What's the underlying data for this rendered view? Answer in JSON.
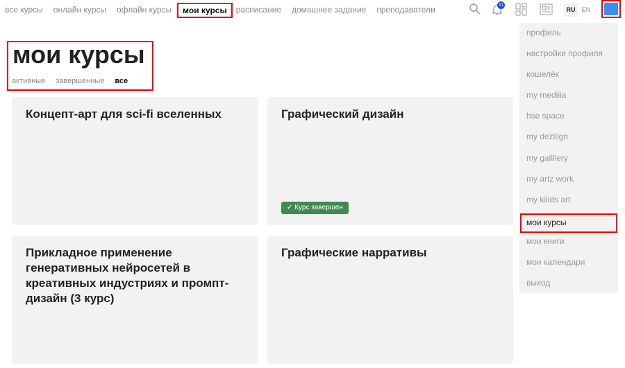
{
  "nav": [
    "все курсы",
    "онлайн курсы",
    "офлайн курсы",
    "мои курсы",
    "расписание",
    "домашнее задание",
    "преподаватели"
  ],
  "header": {
    "notifications": "11",
    "lang_ru": "RU",
    "lang_en": "EN"
  },
  "page": {
    "title": "мои курсы",
    "filters": [
      "активные",
      "завершенные",
      "все"
    ]
  },
  "courses": [
    {
      "title": "Концепт-арт для sci-fi вселенных"
    },
    {
      "title": "Графический дизайн",
      "badge": "Курс завершен"
    },
    {
      "title": "Прикладное применение генеративных нейросетей в креативных индустриях и промпт-дизайн (3 курс)"
    },
    {
      "title": "Графические нарративы"
    }
  ],
  "menu": [
    "профиль",
    "настройки профиля",
    "кошелёк",
    "my mediiia",
    "hse space",
    "my deziiign",
    "my gallllery",
    "my artz work",
    "my kiiids art",
    "мои курсы",
    "мои книги",
    "мои календари",
    "выход"
  ]
}
